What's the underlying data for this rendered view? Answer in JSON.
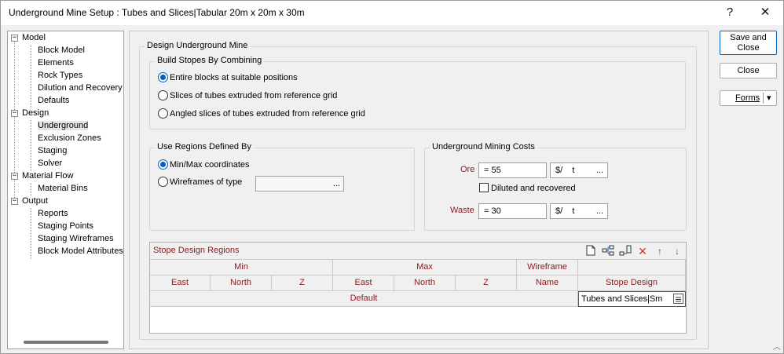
{
  "window": {
    "title": "Underground Mine Setup : Tubes and Slices|Tabular 20m x 20m x 30m",
    "help_label": "?",
    "close_label": "✕"
  },
  "tree": {
    "model": "Model",
    "block_model": "Block Model",
    "elements": "Elements",
    "rock_types": "Rock Types",
    "dilution": "Dilution and Recovery",
    "defaults": "Defaults",
    "design": "Design",
    "underground": "Underground",
    "exclusion": "Exclusion Zones",
    "staging": "Staging",
    "solver": "Solver",
    "material_flow": "Material Flow",
    "material_bins": "Material Bins",
    "output": "Output",
    "reports": "Reports",
    "staging_points": "Staging Points",
    "staging_wireframes": "Staging Wireframes",
    "block_model_attributes": "Block Model Attributes"
  },
  "panel": {
    "title": "Design Underground Mine",
    "build": {
      "label": "Build Stopes By Combining",
      "opt1": "Entire blocks at suitable positions",
      "opt2": "Slices of tubes extruded from reference grid",
      "opt3": "Angled slices of tubes extruded from reference grid"
    },
    "regions": {
      "label": "Use Regions Defined By",
      "opt1": "Min/Max coordinates",
      "opt2": "Wireframes of type",
      "browse": "..."
    },
    "costs": {
      "label": "Underground Mining Costs",
      "ore_label": "Ore",
      "ore_value": "=    55",
      "ore_unit": "$/    t",
      "browse": "...",
      "diluted": "Diluted and recovered",
      "waste_label": "Waste",
      "waste_value": "=    30",
      "waste_unit": "$/    t"
    },
    "grid": {
      "title": "Stope Design Regions",
      "min": "Min",
      "max": "Max",
      "wireframe": "Wireframe",
      "east": "East",
      "north": "North",
      "z": "Z",
      "name": "Name",
      "stope_design": "Stope Design",
      "row_default": "Default",
      "row_value": "Tubes and Slices|Sm"
    }
  },
  "buttons": {
    "save_close": "Save and Close",
    "close": "Close",
    "forms": "Forms",
    "forms_arrow": "▾"
  }
}
